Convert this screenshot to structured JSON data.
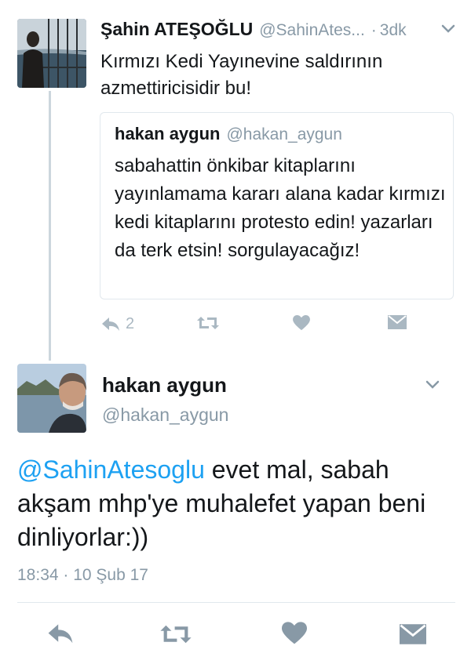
{
  "reply": {
    "author_name": "Şahin ATEŞOĞLU",
    "author_handle": "@SahinAtes...",
    "separator": "·",
    "time": "3dk",
    "text": "Kırmızı Kedi Yayınevine saldırının azmettiricisidir bu!",
    "quoted": {
      "author_name": "hakan aygun",
      "author_handle": "@hakan_aygun",
      "text": "sabahattin önkibar kitaplarını yayınlamama kararı alana kadar kırmızı kedi kitaplarını protesto edin! yazarları da terk etsin! sorgulayacağız!"
    },
    "actions": {
      "reply_count": "2"
    }
  },
  "main_tweet": {
    "author_name": "hakan aygun",
    "author_handle": "@hakan_aygun",
    "mention": "@SahinAtesoglu",
    "text": " evet mal, sabah akşam mhp'ye muhalefet yapan beni dinliyorlar:))",
    "timestamp": "18:34 · 10 Şub 17"
  },
  "colors": {
    "link": "#1da1f2",
    "muted": "#8899a6",
    "icon": "#aab8c2",
    "border": "#e1e8ed",
    "thread_line": "#ccd6dd"
  },
  "icons": [
    "chevron-down-icon",
    "reply-icon",
    "retweet-icon",
    "like-heart-icon",
    "direct-message-icon"
  ]
}
